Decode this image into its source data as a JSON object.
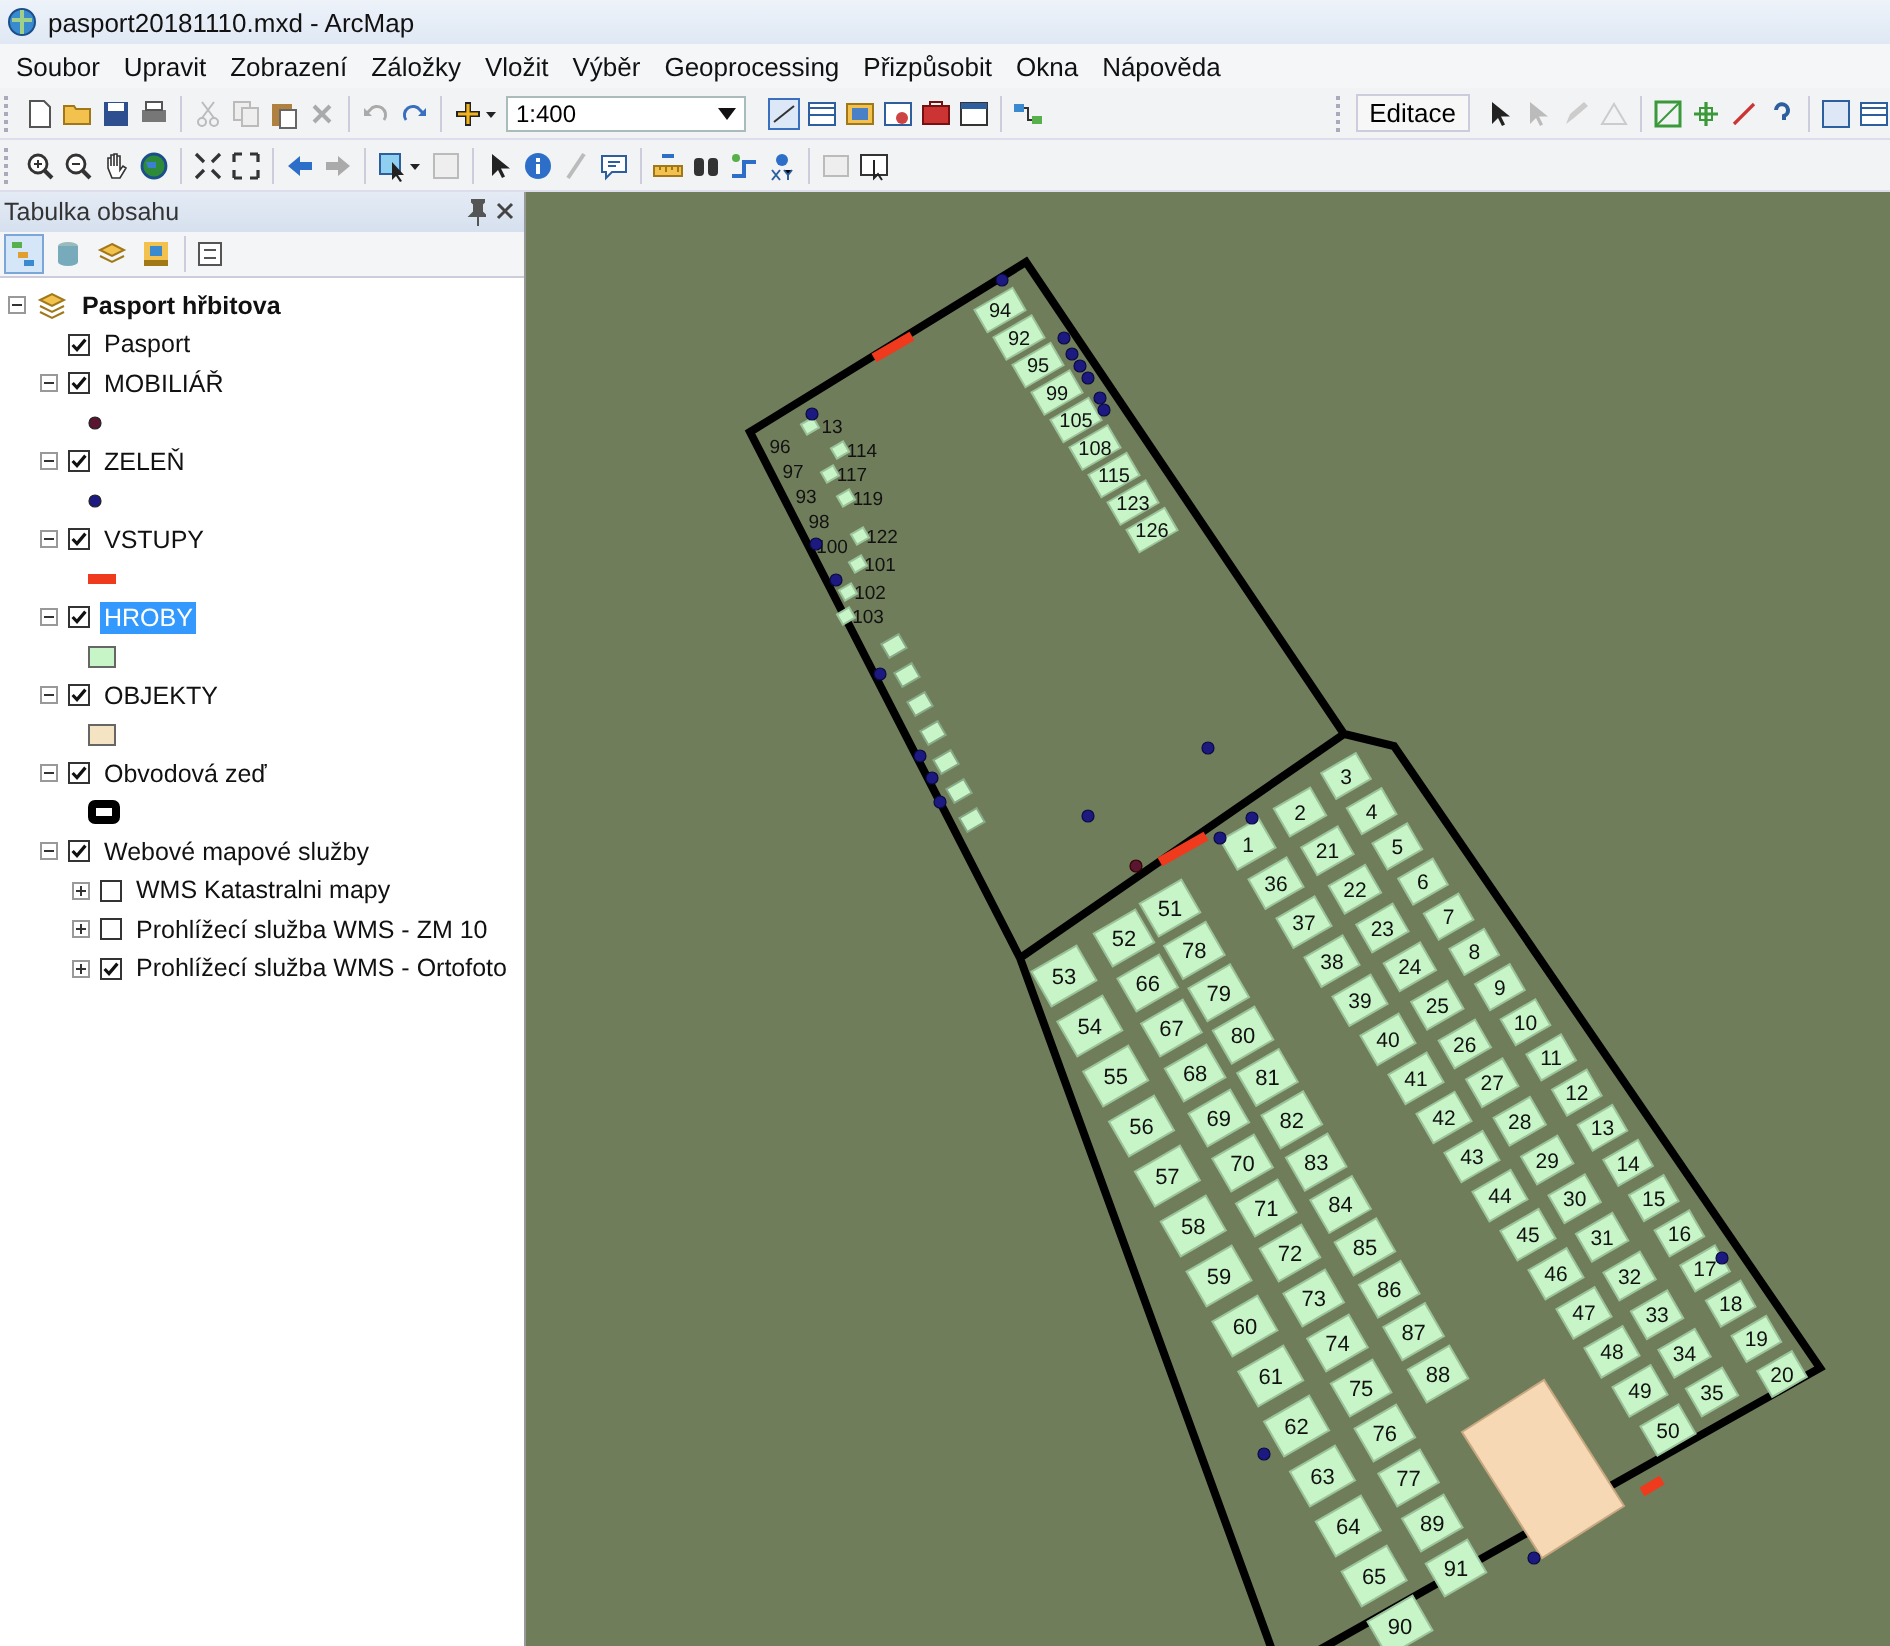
{
  "window": {
    "title": "pasport20181110.mxd - ArcMap"
  },
  "menu": [
    "Soubor",
    "Upravit",
    "Zobrazení",
    "Záložky",
    "Vložit",
    "Výběr",
    "Geoprocessing",
    "Přizpůsobit",
    "Okna",
    "Nápověda"
  ],
  "toolbar": {
    "scale": "1:400",
    "editor_menu": "Editace"
  },
  "toc": {
    "title": "Tabulka obsahu",
    "view_buttons": [
      {
        "selected": true
      },
      {
        "selected": false
      },
      {
        "selected": false
      },
      {
        "selected": false
      }
    ],
    "tree": [
      {
        "label": "Pasport hřbitova",
        "expanded": true,
        "selected": false,
        "children": [
          {
            "label": "Pasport",
            "checked": true,
            "selected": false
          },
          {
            "label": "MOBILIÁŘ",
            "checked": true,
            "expanded": true,
            "selected": false,
            "legend": {
              "kind": "point",
              "color": "#5a1530"
            }
          },
          {
            "label": "ZELEŇ",
            "checked": true,
            "expanded": true,
            "selected": false,
            "legend": {
              "kind": "point",
              "color": "#1c1a80"
            }
          },
          {
            "label": "VSTUPY",
            "checked": true,
            "expanded": true,
            "selected": false,
            "legend": {
              "kind": "line",
              "color": "#f03a1e"
            }
          },
          {
            "label": "HROBY",
            "checked": true,
            "expanded": true,
            "selected": true,
            "legend": {
              "kind": "fill",
              "color": "#c8f5c8"
            }
          },
          {
            "label": "OBJEKTY",
            "checked": true,
            "expanded": true,
            "selected": false,
            "legend": {
              "kind": "fill",
              "color": "#f4e4c4"
            }
          },
          {
            "label": "Obvodová zeď",
            "checked": true,
            "expanded": true,
            "selected": false,
            "legend": {
              "kind": "wall",
              "color": "#000000"
            }
          },
          {
            "label": "Webové mapové služby",
            "checked": true,
            "expanded": true,
            "selected": false,
            "children": [
              {
                "label": "WMS Katastralni mapy",
                "checked": false,
                "expanded": false,
                "selected": false
              },
              {
                "label": "Prohlížecí služba WMS - ZM 10",
                "checked": false,
                "expanded": false,
                "selected": false
              },
              {
                "label": "Prohlížecí služba WMS - Ortofoto",
                "checked": true,
                "expanded": false,
                "selected": false
              }
            ]
          }
        ]
      }
    ]
  },
  "map": {
    "grave_columns": [
      [
        "94",
        "92",
        "95",
        "99",
        "105",
        "108",
        "115",
        "123",
        "126"
      ],
      [
        "96",
        "97",
        "93",
        "98",
        "100"
      ],
      [
        "13",
        "114",
        "117",
        "119",
        "122",
        "101",
        "102",
        "103"
      ],
      [
        "3",
        "4",
        "5",
        "6",
        "7",
        "8",
        "9",
        "10",
        "11",
        "12",
        "13",
        "14",
        "15",
        "16",
        "17",
        "18",
        "19",
        "20"
      ],
      [
        "2",
        "21",
        "22",
        "23",
        "24",
        "25",
        "26",
        "27",
        "28",
        "29",
        "30",
        "31",
        "32",
        "33",
        "34",
        "35"
      ],
      [
        "1",
        "36",
        "37",
        "38",
        "39",
        "40",
        "41",
        "42",
        "43",
        "44",
        "45",
        "46",
        "47",
        "48",
        "49",
        "50"
      ],
      [
        "51",
        "78",
        "79",
        "80",
        "81",
        "82",
        "83",
        "84",
        "85",
        "86",
        "87",
        "88"
      ],
      [
        "52",
        "66",
        "67",
        "68",
        "69",
        "70",
        "71",
        "72",
        "73",
        "74",
        "75",
        "76",
        "77",
        "89",
        "91"
      ],
      [
        "53",
        "54",
        "55",
        "56",
        "57",
        "58",
        "59",
        "60",
        "61",
        "62",
        "63",
        "64",
        "65",
        "90"
      ]
    ]
  }
}
